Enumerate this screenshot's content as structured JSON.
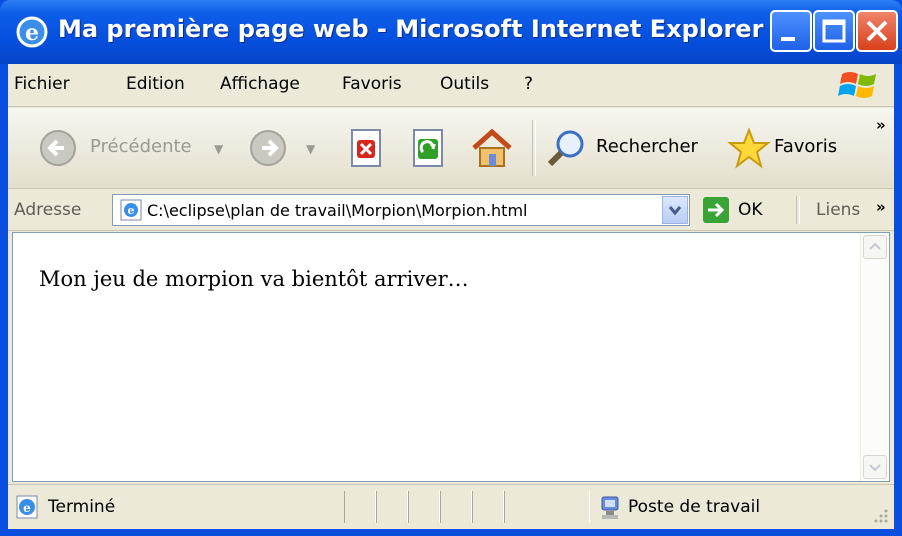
{
  "window": {
    "title": "Ma première page web - Microsoft Internet Explorer",
    "buttons": [
      "minimize",
      "maximize",
      "close"
    ]
  },
  "menu": {
    "items": [
      {
        "label": "Fichier"
      },
      {
        "label": "Edition"
      },
      {
        "label": "Affichage"
      },
      {
        "label": "Favoris"
      },
      {
        "label": "Outils"
      },
      {
        "label": "?"
      }
    ]
  },
  "toolbar": {
    "back_label": "Précédente",
    "search_label": "Rechercher",
    "favorites_label": "Favoris",
    "icons": [
      "back-icon",
      "forward-icon",
      "stop-icon",
      "refresh-icon",
      "home-icon",
      "search-icon",
      "favorites-star-icon"
    ]
  },
  "address": {
    "label": "Adresse",
    "value": "C:\\eclipse\\plan de travail\\Morpion\\Morpion.html",
    "go_label": "OK",
    "links_label": "Liens"
  },
  "page": {
    "text": "Mon jeu de morpion va bientôt arriver…"
  },
  "status": {
    "text": "Terminé",
    "zone": "Poste de travail"
  },
  "colors": {
    "titlebar": "#0550df",
    "chrome": "#ece9d8",
    "close_button": "#d8401c"
  }
}
